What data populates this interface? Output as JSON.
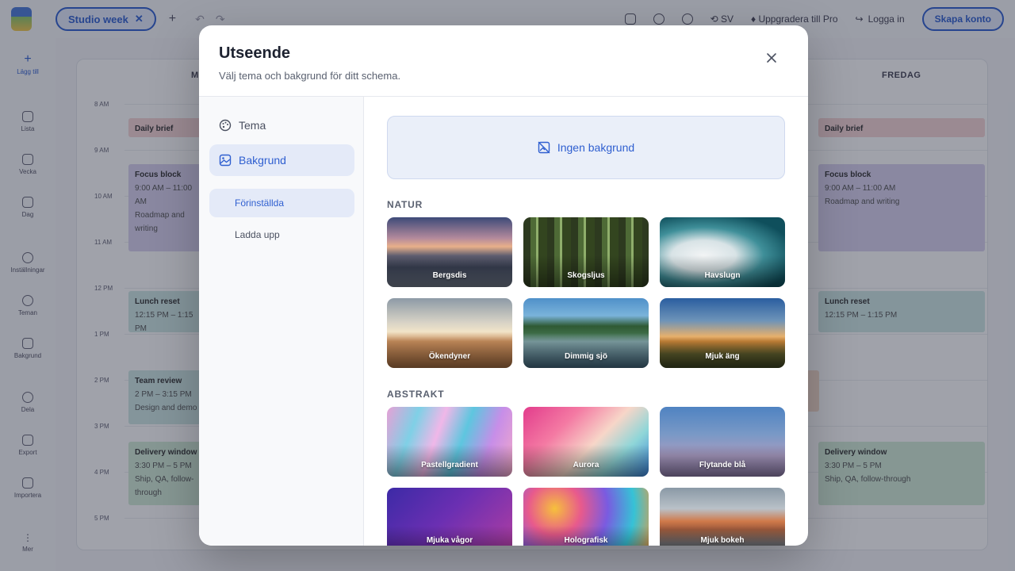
{
  "app": {
    "view_pill": "Studio week",
    "language": "SV",
    "upgrade": "Uppgradera till Pro",
    "login": "Logga in",
    "create_account": "Skapa konto",
    "sidebar": [
      "Lägg till",
      "Lista",
      "Vecka",
      "Dag",
      "Inställningar",
      "Teman",
      "Bakgrund",
      "Dela",
      "Export",
      "Importera",
      "Mer"
    ],
    "days": {
      "first": "M",
      "last": "FREDAG"
    },
    "times": [
      "8 AM",
      "9 AM",
      "10 AM",
      "11 AM",
      "12 PM",
      "1 PM",
      "2 PM",
      "3 PM",
      "4 PM",
      "5 PM"
    ],
    "events": {
      "daily_brief": "Daily brief",
      "focus_block": "Focus block",
      "focus_time": "9:00 AM – 11:00 AM",
      "focus_desc": "Roadmap and writing",
      "lunch": "Lunch reset",
      "lunch_time": "12:15 PM – 1:15 PM",
      "team": "Team review",
      "team_time": "2 PM – 3:15 PM",
      "team_desc": "Design and demo",
      "delivery": "Delivery window",
      "delivery_time": "3:30 PM – 5 PM",
      "delivery_desc": "Ship, QA, follow-through"
    }
  },
  "modal": {
    "title": "Utseende",
    "subtitle": "Välj tema och bakgrund för ditt schema.",
    "nav": {
      "theme": "Tema",
      "background": "Bakgrund",
      "presets": "Förinställda",
      "upload": "Ladda upp"
    },
    "no_background": "Ingen bakgrund",
    "sections": {
      "nature": "NATUR",
      "abstract": "ABSTRAKT"
    },
    "tiles": [
      {
        "label": "Bergsdis"
      },
      {
        "label": "Skogsljus"
      },
      {
        "label": "Havslugn"
      },
      {
        "label": "Ökendyner"
      },
      {
        "label": "Dimmig sjö"
      },
      {
        "label": "Mjuk äng"
      },
      {
        "label": "Pastellgradient"
      },
      {
        "label": "Aurora"
      },
      {
        "label": "Flytande blå"
      },
      {
        "label": "Mjuka vågor"
      },
      {
        "label": "Holografisk"
      },
      {
        "label": "Mjuk bokeh"
      }
    ]
  }
}
